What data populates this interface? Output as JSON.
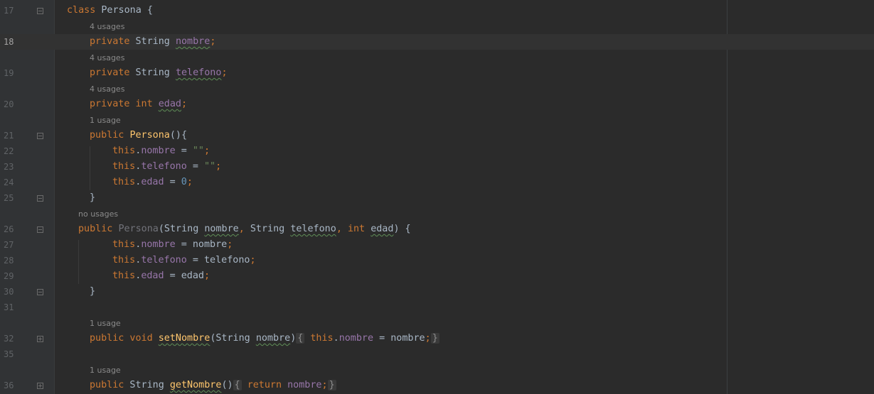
{
  "line_numbers": [
    "17",
    "18",
    "19",
    "20",
    "21",
    "22",
    "23",
    "24",
    "25",
    "26",
    "27",
    "28",
    "29",
    "30",
    "31",
    "32",
    "35",
    "36"
  ],
  "hints": {
    "nombre": "4 usages",
    "telefono": "4 usages",
    "edad": "4 usages",
    "ctor_default": "1 usage",
    "ctor_params": "no usages",
    "setNombre": "1 usage",
    "getNombre": "1 usage"
  },
  "code": {
    "l17": {
      "kw": "class",
      "name": "Persona",
      "tail": " {"
    },
    "l18": {
      "kw": "private",
      "type": " String ",
      "field": "nombre",
      "semi": ";"
    },
    "l19": {
      "kw": "private",
      "type": " String ",
      "field": "telefono",
      "semi": ";"
    },
    "l20": {
      "kw": "private int",
      "field": "edad",
      "semi": ";"
    },
    "l21": {
      "kw": "public",
      "name": "Persona",
      "tail": "(){"
    },
    "l22": {
      "this": "this",
      "field": "nombre",
      "op": " = ",
      "str": "\"\"",
      "semi": ";"
    },
    "l23": {
      "this": "this",
      "field": "telefono",
      "op": " = ",
      "str": "\"\"",
      "semi": ";"
    },
    "l24": {
      "this": "this",
      "field": "edad",
      "op": " = ",
      "num": "0",
      "semi": ";"
    },
    "l25": {
      "text": "}"
    },
    "l26": {
      "kw": "public",
      "name": "Persona",
      "p1": "(String ",
      "a1": "nombre",
      "c1": ", ",
      "t2": "String ",
      "a2": "telefono",
      "c2": ", ",
      "k3": "int",
      "a3": "edad",
      "tail": ") {"
    },
    "l27": {
      "this": "this",
      "field": "nombre",
      "op": " = nombre",
      "semi": ";"
    },
    "l28": {
      "this": "this",
      "field": "telefono",
      "op": " = telefono",
      "semi": ";"
    },
    "l29": {
      "this": "this",
      "field": "edad",
      "op": " = edad",
      "semi": ";"
    },
    "l30": {
      "text": "}"
    },
    "l32": {
      "kw": "public void",
      "name": "setNombre",
      "p1": "(String ",
      "a1": "nombre",
      "p2": ")",
      "b1": "{",
      "this": "this",
      "field": "nombre",
      "op": " = nombre",
      "semi": ";",
      "b2": "}"
    },
    "l36": {
      "kw": "public",
      "type": " String ",
      "name": "getNombre",
      "p1": "()",
      "b1": "{",
      "ret": "return",
      "field": "nombre",
      "semi": ";",
      "b2": "}"
    }
  },
  "colors": {
    "background": "#2b2b2b",
    "gutter": "#313335",
    "keyword": "#cc7832",
    "field": "#9876aa",
    "string": "#6a8759",
    "number": "#6897bb",
    "method": "#ffc66d",
    "text": "#a9b7c6"
  }
}
